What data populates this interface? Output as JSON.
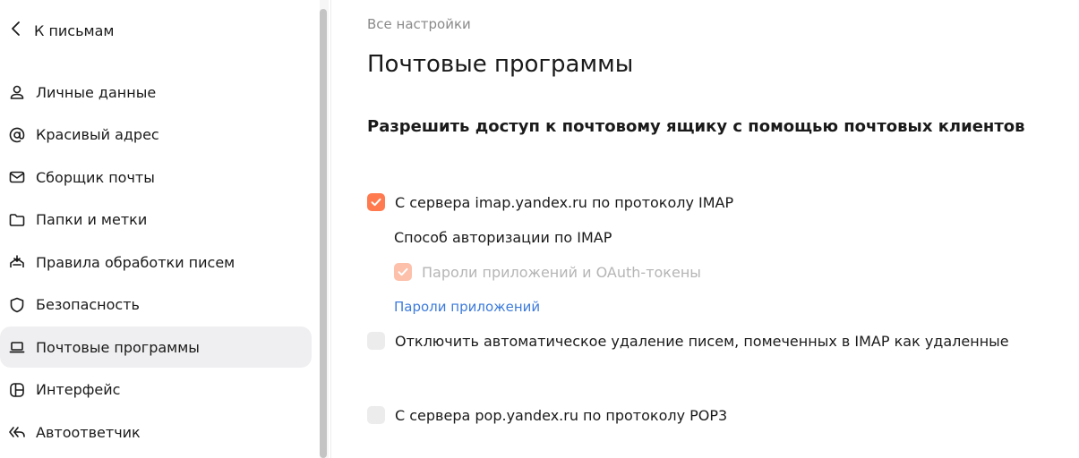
{
  "sidebar": {
    "back_label": "К письмам",
    "items": [
      {
        "label": "Личные данные",
        "icon": "person-icon"
      },
      {
        "label": "Красивый адрес",
        "icon": "at-sign-icon"
      },
      {
        "label": "Сборщик почты",
        "icon": "envelope-icon"
      },
      {
        "label": "Папки и метки",
        "icon": "folder-icon"
      },
      {
        "label": "Правила обработки писем",
        "icon": "rules-icon"
      },
      {
        "label": "Безопасность",
        "icon": "shield-icon"
      },
      {
        "label": "Почтовые программы",
        "icon": "laptop-icon",
        "active": true
      },
      {
        "label": "Интерфейс",
        "icon": "layout-icon"
      },
      {
        "label": "Автоответчик",
        "icon": "reply-all-icon"
      }
    ]
  },
  "main": {
    "breadcrumb": "Все настройки",
    "title": "Почтовые программы",
    "section_title": "Разрешить доступ к почтовому ящику с помощью почтовых клиентов",
    "imap": {
      "label": "С сервера imap.yandex.ru по протоколу IMAP",
      "checked": true
    },
    "auth_method_label": "Способ авторизации по IMAP",
    "app_passwords_option": {
      "label": "Пароли приложений и OAuth-токены",
      "checked": true,
      "disabled": true
    },
    "app_passwords_link": "Пароли приложений",
    "disable_autodelete": {
      "label": "Отключить автоматическое удаление писем, помеченных в IMAP как удаленные",
      "checked": false
    },
    "pop3": {
      "label": "С сервера pop.yandex.ru по протоколу POP3",
      "checked": false
    }
  },
  "colors": {
    "accent": "#ff7a4f",
    "accent_disabled": "#fcc0ab",
    "link": "#3d7bdb",
    "active_bg": "#efeff1"
  }
}
